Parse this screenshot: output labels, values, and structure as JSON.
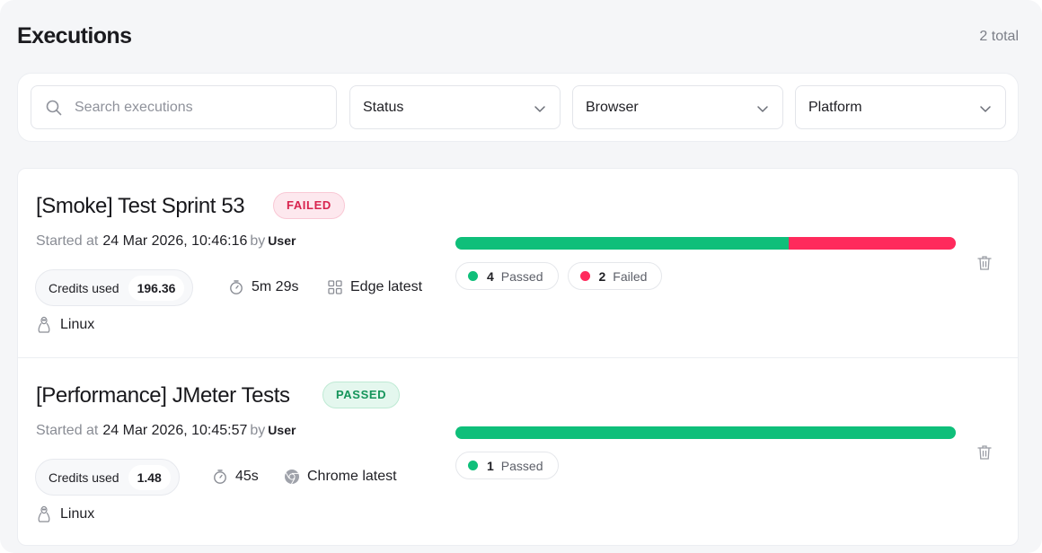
{
  "header": {
    "title": "Executions",
    "total": "2 total"
  },
  "filters": {
    "search_placeholder": "Search executions",
    "status_label": "Status",
    "browser_label": "Browser",
    "platform_label": "Platform"
  },
  "colors": {
    "passed": "#0fbf7a",
    "failed": "#ff2a5c",
    "failed_badge_bg": "#fde8ee",
    "passed_badge_bg": "#e4f7ee"
  },
  "executions": [
    {
      "title": "[Smoke] Test Sprint 53",
      "status": "FAILED",
      "started_prefix": "Started at",
      "started_at": "24 Mar 2026, 10:46:16",
      "by": "by",
      "user": "User",
      "credits_label": "Credits used",
      "credits_value": "196.36",
      "duration": "5m 29s",
      "browser": "Edge latest",
      "browser_icon": "grid-icon",
      "platform": "Linux",
      "passed_count": "4",
      "passed_label": "Passed",
      "failed_count": "2",
      "failed_label": "Failed",
      "passed_num": 4,
      "failed_num": 2
    },
    {
      "title": "[Performance] JMeter Tests",
      "status": "PASSED",
      "started_prefix": "Started at",
      "started_at": "24 Mar 2026, 10:45:57",
      "by": "by",
      "user": "User",
      "credits_label": "Credits used",
      "credits_value": "1.48",
      "duration": "45s",
      "browser": "Chrome latest",
      "browser_icon": "chrome-icon",
      "platform": "Linux",
      "passed_count": "1",
      "passed_label": "Passed",
      "passed_num": 1,
      "failed_num": 0
    }
  ]
}
